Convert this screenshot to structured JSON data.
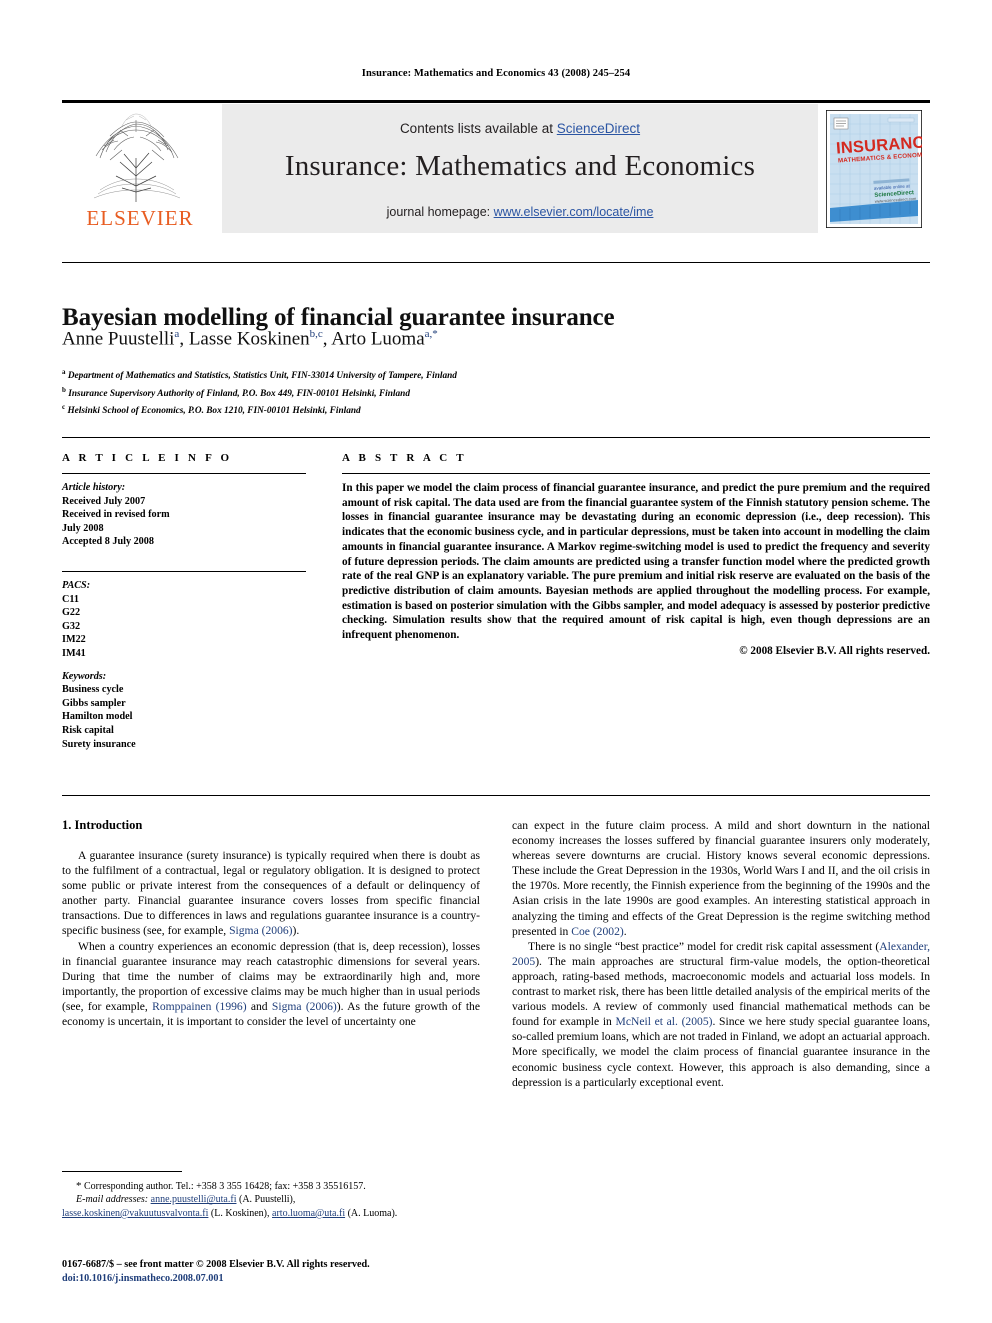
{
  "running_head": "Insurance: Mathematics and Economics 43 (2008) 245–254",
  "banner": {
    "contents_prefix": "Contents lists available at ",
    "sciencedirect": "ScienceDirect",
    "journal_title": "Insurance: Mathematics and Economics",
    "homepage_prefix": "journal homepage: ",
    "homepage_url": "www.elsevier.com/locate/ime",
    "publisher_wordmark": "ELSEVIER",
    "publisher_logo_icon": "elsevier-tree-logo",
    "cover_title": "INSURANCE",
    "cover_subtitle": "MATHEMATICS & ECONOMICS",
    "accent_blue": "#2b55a3",
    "elsevier_orange": "#E85D22",
    "cover_red": "#d4291f",
    "cover_band_blue": "#3e8ed0"
  },
  "article": {
    "title": "Bayesian modelling of financial guarantee insurance",
    "authors_html": "Anne Puustelli<sup>a</sup>, Lasse Koskinen<sup>b,c</sup>, Arto Luoma<sup>a,*</sup>",
    "affiliations": [
      {
        "marker": "a",
        "text": "Department of Mathematics and Statistics, Statistics Unit, FIN-33014 University of Tampere, Finland"
      },
      {
        "marker": "b",
        "text": "Insurance Supervisory Authority of Finland, P.O. Box 449, FIN-00101 Helsinki, Finland"
      },
      {
        "marker": "c",
        "text": "Helsinki School of Economics, P.O. Box 1210, FIN-00101 Helsinki, Finland"
      }
    ]
  },
  "info": {
    "heading": "A R T I C L E    I N F O",
    "history_label": "Article history:",
    "history_lines": [
      "Received July 2007",
      "Received in revised form",
      "July 2008",
      "Accepted 8 July 2008"
    ],
    "pacs_label": "PACS:",
    "pacs": [
      "C11",
      "G22",
      "G32",
      "IM22",
      "IM41"
    ],
    "keywords_label": "Keywords:",
    "keywords": [
      "Business cycle",
      "Gibbs sampler",
      "Hamilton model",
      "Risk capital",
      "Surety insurance"
    ]
  },
  "abstract": {
    "heading": "A B S T R A C T",
    "text": "In this paper we model the claim process of financial guarantee insurance, and predict the pure premium and the required amount of risk capital. The data used are from the financial guarantee system of the Finnish statutory pension scheme. The losses in financial guarantee insurance may be devastating during an economic depression (i.e., deep recession). This indicates that the economic business cycle, and in particular depressions, must be taken into account in modelling the claim amounts in financial guarantee insurance. A Markov regime-switching model is used to predict the frequency and severity of future depression periods. The claim amounts are predicted using a transfer function model where the predicted growth rate of the real GNP is an explanatory variable. The pure premium and initial risk reserve are evaluated on the basis of the predictive distribution of claim amounts. Bayesian methods are applied throughout the modelling process. For example, estimation is based on posterior simulation with the Gibbs sampler, and model adequacy is assessed by posterior predictive checking. Simulation results show that the required amount of risk capital is high, even though depressions are an infrequent phenomenon.",
    "copyright": "© 2008 Elsevier B.V. All rights reserved."
  },
  "body": {
    "section_title": "1. Introduction",
    "left_paragraphs": [
      "A guarantee insurance (surety insurance) is typically required when there is doubt as to the fulfilment of a contractual, legal or regulatory obligation. It is designed to protect some public or private interest from the consequences of a default or delinquency of another party. Financial guarantee insurance covers losses from specific financial transactions. Due to differences in laws and regulations guarantee insurance is a country-specific business (see, for example, Sigma (2006)).",
      "When a country experiences an economic depression (that is, deep recession), losses in financial guarantee insurance may reach catastrophic dimensions for several years. During that time the number of claims may be extraordinarily high and, more importantly, the proportion of excessive claims may be much higher than in usual periods (see, for example, Romppainen (1996) and Sigma (2006)). As the future growth of the economy is uncertain, it is important to consider the level of uncertainty one"
    ],
    "right_paragraphs": [
      "can expect in the future claim process. A mild and short downturn in the national economy increases the losses suffered by financial guarantee insurers only moderately, whereas severe downturns are crucial. History knows several economic depressions. These include the Great Depression in the 1930s, World Wars I and II, and the oil crisis in the 1970s. More recently, the Finnish experience from the beginning of the 1990s and the Asian crisis in the late 1990s are good examples. An interesting statistical approach in analyzing the timing and effects of the Great Depression is the regime switching method presented in Coe (2002).",
      "There is no single “best practice” model for credit risk capital assessment (Alexander, 2005). The main approaches are structural firm-value models, the option-theoretical approach, rating-based methods, macroeconomic models and actuarial loss models. In contrast to market risk, there has been little detailed analysis of the empirical merits of the various models. A review of commonly used financial mathematical methods can be found for example in McNeil et al. (2005). Since we here study special guarantee loans, so-called premium loans, which are not traded in Finland, we adopt an actuarial approach. More specifically, we model the claim process of financial guarantee insurance in the economic business cycle context. However, this approach is also demanding, since a depression is a particularly exceptional event."
    ],
    "inline_references": [
      "Sigma (2006)",
      "Romppainen (1996)",
      "Coe (2002)",
      "Alexander, 2005",
      "McNeil et al. (2005)"
    ]
  },
  "footnotes": {
    "corresponding_marker": "*",
    "corresponding_text": "Corresponding author. Tel.: +358 3 355 16428; fax: +358 3 35516157.",
    "email_label": "E-mail addresses:",
    "emails": [
      {
        "address": "anne.puustelli@uta.fi",
        "person": "(A. Puustelli),"
      },
      {
        "address": "lasse.koskinen@vakuutusvalvonta.fi",
        "person": "(L. Koskinen),"
      },
      {
        "address": "arto.luoma@uta.fi",
        "person": "(A. Luoma)."
      }
    ]
  },
  "imprint": {
    "line1": "0167-6687/$ – see front matter © 2008 Elsevier B.V. All rights reserved.",
    "doi": "doi:10.1016/j.insmatheco.2008.07.001"
  }
}
